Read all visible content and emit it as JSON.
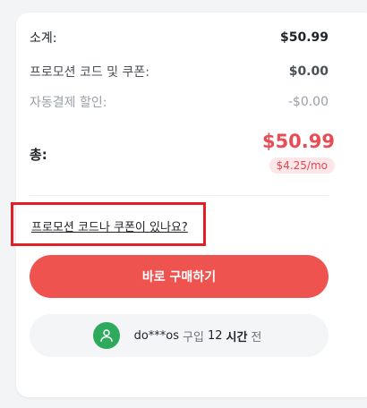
{
  "summary": {
    "subtotal_label": "소계:",
    "subtotal_value": "$50.99",
    "promo_label": "프로모션 코드 및 쿠폰:",
    "promo_value": "$0.00",
    "autopay_label": "자동결제 할인:",
    "autopay_value": "-$0.00"
  },
  "total": {
    "label": "총:",
    "value": "$50.99",
    "monthly": "$4.25/mo"
  },
  "promo_link": "프로모션 코드나 쿠폰이 있나요?",
  "buy_button": "바로 구매하기",
  "social_proof": {
    "user": "do***os",
    "action": "구입",
    "time_value": "12",
    "time_unit": "시간",
    "suffix": "전",
    "icon": "user-icon"
  },
  "colors": {
    "accent": "#ef5350",
    "price": "#e84c55",
    "avatar": "#2eaa5c",
    "highlight_box": "#e01f26"
  }
}
